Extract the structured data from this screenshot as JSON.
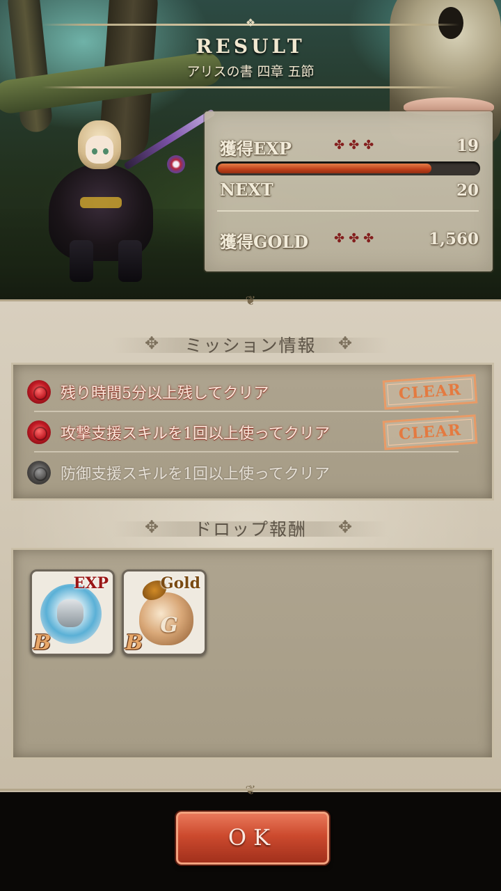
{
  "header": {
    "title": "RESULT",
    "subtitle": "アリスの書 四章 五節"
  },
  "stats": {
    "exp_label": "獲得EXP",
    "exp_value": "19",
    "exp_progress": 0.82,
    "next_label": "NEXT",
    "next_value": "20",
    "gold_label": "獲得GOLD",
    "gold_value": "1,560"
  },
  "missions": {
    "title": "ミッション情報",
    "items": [
      {
        "text": "残り時間5分以上残してクリア",
        "status": "CLEAR"
      },
      {
        "text": "攻撃支援スキルを1回以上使ってクリア",
        "status": "CLEAR"
      },
      {
        "text": "防御支援スキルを1回以上使ってクリア",
        "status": ""
      }
    ]
  },
  "drops": {
    "title": "ドロップ報酬",
    "items": [
      {
        "tag": "EXP",
        "rank": "B",
        "icon": "exp-armor-icon"
      },
      {
        "tag": "Gold",
        "rank": "B",
        "icon": "gold-bag-icon"
      }
    ]
  },
  "ok_label": "OK"
}
